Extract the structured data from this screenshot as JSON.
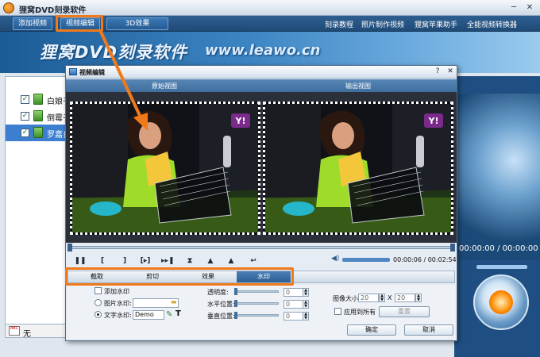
{
  "app": {
    "title": "狸窝DVD刻录软件",
    "minimize": "─",
    "close": "✕"
  },
  "toolbar": {
    "add_video": "添加视频",
    "edit_video": "视频编辑",
    "effect_3d": "3D效果",
    "links": [
      "刻录教程",
      "照片制作视频",
      "狸窝苹果助手",
      "全能视频转换器"
    ]
  },
  "banner": {
    "title": "狸窝DVD刻录软件",
    "url": "www.leawo.cn"
  },
  "file_list": {
    "items": [
      {
        "name": "白娘子",
        "checked": true,
        "selected": false
      },
      {
        "name": "倒霉子",
        "checked": true,
        "selected": false
      },
      {
        "name": "罗嘉良",
        "checked": true,
        "selected": true
      }
    ],
    "check_mark": "✓",
    "subtitle_icon_text": "ABC",
    "subtitle_label": "无"
  },
  "right_panel": {
    "time": "00:00:00 / 00:00:00"
  },
  "dialog": {
    "title": "视频编辑",
    "close": "✕",
    "help": "?",
    "original_view": "原始视图",
    "output_view": "输出视图",
    "logo_text": "Y!",
    "time": "00:00:06 / 00:02:54",
    "controls": [
      "❚❚",
      "[",
      "]",
      "[▸]",
      "▸▸❚",
      "⧗",
      "▲",
      "▲",
      "↩"
    ],
    "tabs": [
      {
        "label": "截取",
        "active": false
      },
      {
        "label": "剪切",
        "active": false
      },
      {
        "label": "效果",
        "active": false
      },
      {
        "label": "水印",
        "active": true
      }
    ],
    "watermark": {
      "add_label": "添加水印",
      "image_label": "图片水印:",
      "text_label": "文字水印:",
      "text_value": "Demo",
      "transparency_label": "透明度:",
      "horizontal_label": "水平位置:",
      "vertical_label": "垂直位置:",
      "transparency_value": "0",
      "horizontal_value": "0",
      "vertical_value": "0",
      "image_size_label": "图像大小:",
      "width": "20",
      "height": "20",
      "times": "X",
      "apply_all_label": "应用到所有",
      "reset_label": "重置",
      "spin_up": "▲",
      "spin_down": "▼",
      "pen_icon": "✎",
      "text_icon": "T"
    },
    "ok": "确定",
    "cancel": "取消"
  },
  "colors": {
    "accent_orange": "#f07a1a",
    "header_blue": "#1f4a76",
    "tab_active": "#2d5f93"
  }
}
